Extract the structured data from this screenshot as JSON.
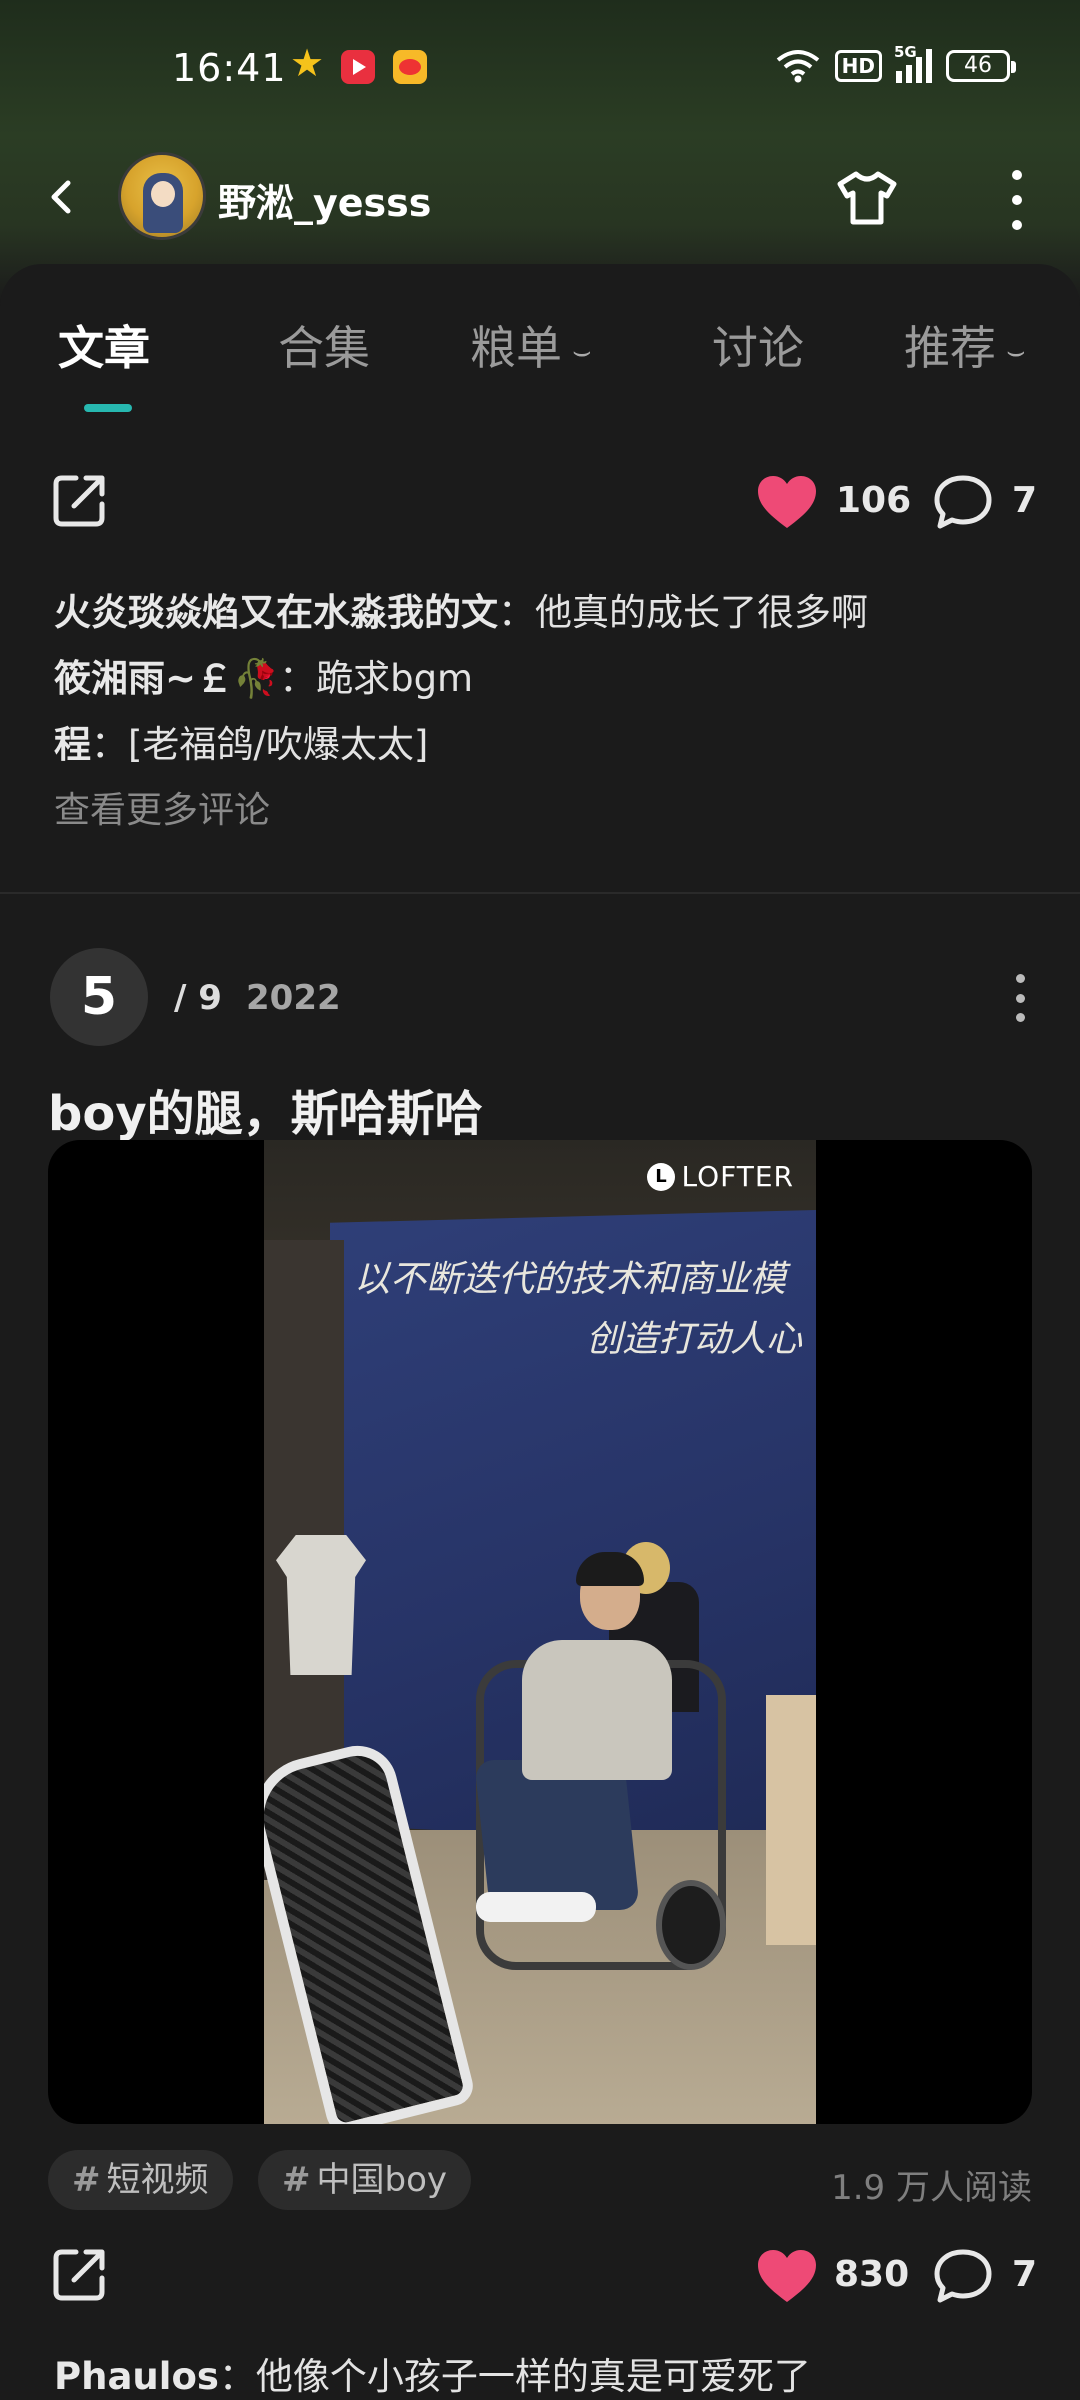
{
  "status_bar": {
    "time": "16:41",
    "network_label": "5G",
    "hd_label": "HD",
    "battery": "46"
  },
  "header": {
    "username": "野淞_yesss"
  },
  "tabs": [
    {
      "label": "文章",
      "active": true
    },
    {
      "label": "合集",
      "active": false
    },
    {
      "label": "粮单",
      "active": false
    },
    {
      "label": "讨论",
      "active": false
    },
    {
      "label": "推荐",
      "active": false
    }
  ],
  "colors": {
    "accent": "#27b8b0",
    "like": "#ee4a76",
    "background": "#1b1b1b"
  },
  "post_prev": {
    "likes": "106",
    "comments_count": "7",
    "comments": [
      {
        "author": "火炎琰焱焰又在水淼我的文",
        "text": "：他真的成长了很多啊"
      },
      {
        "author": "筱湘雨~￡🥀",
        "text": "：跪求bgm"
      },
      {
        "author": "程",
        "text": "：[老福鸽/吹爆太太]"
      }
    ],
    "more_comments": "查看更多评论"
  },
  "post": {
    "page_current": "5",
    "page_total": "/ 9",
    "year": "2022",
    "title": "boy的腿，斯哈斯哈",
    "watermark": "LOFTER",
    "watermark_logo": "L",
    "wall_text_line1": "以不断迭代的技术和商业模",
    "wall_text_line2": "创造打动人心",
    "tags": [
      {
        "hash": "#",
        "label": "短视频"
      },
      {
        "hash": "#",
        "label": "中国boy"
      }
    ],
    "reads": "1.9 万人阅读",
    "likes": "830",
    "comments_count": "7",
    "first_comment": {
      "author": "Phaulos",
      "text": "：他像个小孩子一样的真是可爱死了"
    }
  }
}
